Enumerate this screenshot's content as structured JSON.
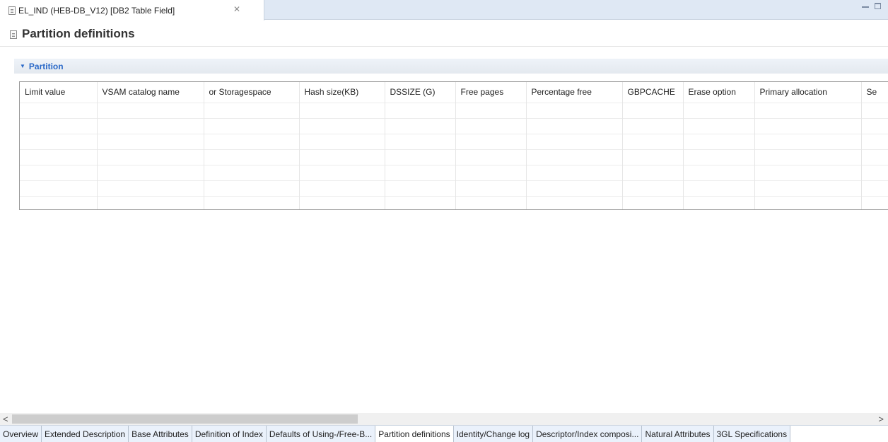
{
  "editor_tab": {
    "title": "EL_IND (HEB-DB_V12)  [DB2 Table Field]",
    "close_glyph": "✕"
  },
  "page": {
    "title": "Partition definitions"
  },
  "section": {
    "title": "Partition"
  },
  "table": {
    "columns": [
      "Limit value",
      "VSAM catalog name",
      "or Storagespace",
      "Hash size(KB)",
      "DSSIZE (G)",
      "Free pages",
      "Percentage free",
      "GBPCACHE",
      "Erase option",
      "Primary allocation",
      "Se"
    ],
    "rows": []
  },
  "scrollbar": {
    "left_glyph": "<",
    "right_glyph": ">",
    "thumb_fraction": 0.4
  },
  "page_tabs": [
    {
      "label": "Overview"
    },
    {
      "label": "Extended Description"
    },
    {
      "label": "Base Attributes"
    },
    {
      "label": "Definition of Index"
    },
    {
      "label": "Defaults of Using-/Free-B..."
    },
    {
      "label": "Partition definitions",
      "active": true
    },
    {
      "label": "Identity/Change log"
    },
    {
      "label": "Descriptor/Index composi..."
    },
    {
      "label": "Natural Attributes"
    },
    {
      "label": "3GL Specifications"
    }
  ],
  "colors": {
    "section_title": "#2a69c8",
    "tabstrip_bg": "#dfe8f4"
  },
  "icons": [
    "document-icon",
    "close-icon",
    "minimize-icon",
    "maximize-icon",
    "collapse-arrow-icon",
    "scroll-left-icon",
    "scroll-right-icon"
  ]
}
